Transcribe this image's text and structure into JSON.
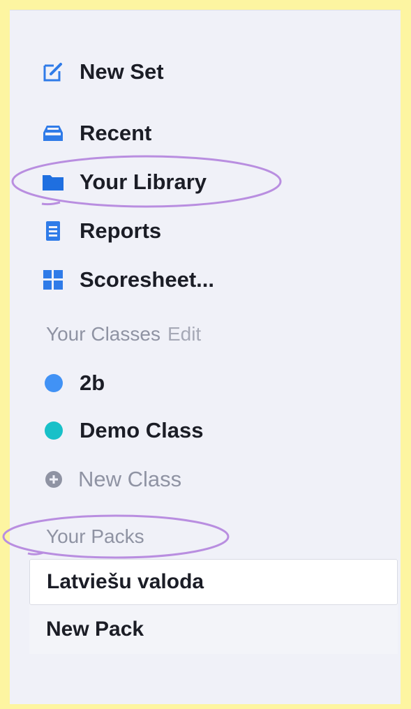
{
  "nav": {
    "items": [
      {
        "label": "New Set",
        "icon": "edit-square-icon"
      },
      {
        "label": "Recent",
        "icon": "inbox-tray-icon"
      },
      {
        "label": "Your Library",
        "icon": "folder-icon"
      },
      {
        "label": "Reports",
        "icon": "report-document-icon"
      },
      {
        "label": "Scoresheet...",
        "icon": "grid-icon"
      }
    ]
  },
  "classes": {
    "header": "Your Classes",
    "edit_label": "Edit",
    "items": [
      {
        "label": "2b",
        "color": "#4192f5"
      },
      {
        "label": "Demo Class",
        "color": "#18c0c8"
      }
    ],
    "new_class_label": "New Class"
  },
  "packs": {
    "header": "Your Packs",
    "items": [
      {
        "label": "Latviešu valoda",
        "selected": true
      },
      {
        "label": "New Pack",
        "selected": false
      }
    ]
  },
  "colors": {
    "icon_blue": "#2f7be8",
    "annotation_purple": "#b98ee0",
    "frame_yellow": "#fdf5a1"
  }
}
